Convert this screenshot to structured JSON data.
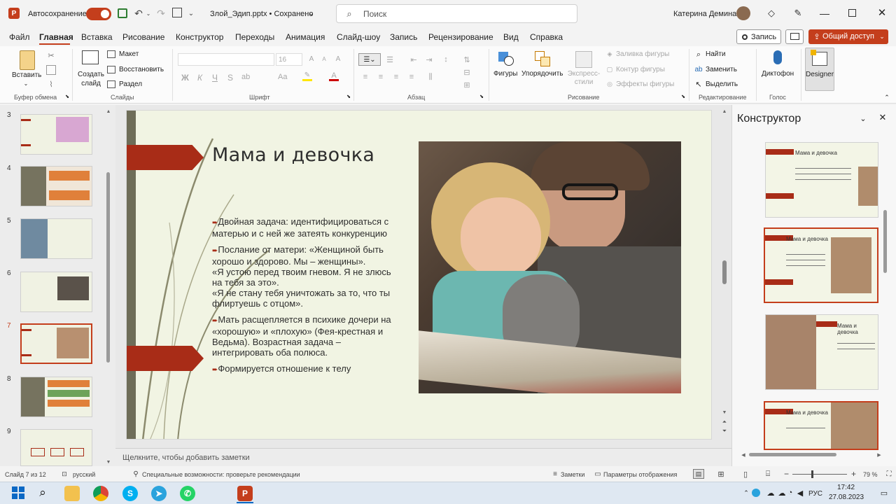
{
  "titlebar": {
    "autosave_label": "Автосохранение",
    "toggle_state": "Вкл",
    "file_title": "Злой_Эдип.pptx • Сохранено",
    "search_placeholder": "Поиск",
    "user_name": "Катерина Демина"
  },
  "menu": {
    "items": [
      "Файл",
      "Главная",
      "Вставка",
      "Рисование",
      "Конструктор",
      "Переходы",
      "Анимация",
      "Слайд-шоу",
      "Запись",
      "Рецензирование",
      "Вид",
      "Справка"
    ],
    "active": "Главная",
    "record_label": "Запись",
    "share_label": "Общий доступ"
  },
  "ribbon": {
    "clipboard": {
      "paste": "Вставить",
      "label": "Буфер обмена"
    },
    "slides": {
      "new_slide": "Создать слайд",
      "layout": "Макет",
      "reset": "Восстановить",
      "section": "Раздел",
      "label": "Слайды"
    },
    "font": {
      "font_size": "16",
      "bold": "Ж",
      "italic": "К",
      "underline": "Ч",
      "strike": "S",
      "spacing": "ab",
      "font_case": "Aa",
      "label": "Шрифт"
    },
    "paragraph": {
      "label": "Абзац"
    },
    "drawing": {
      "shapes": "Фигуры",
      "arrange": "Упорядочить",
      "quick_styles": "Экспресс-стили",
      "fill": "Заливка фигуры",
      "outline": "Контур фигуры",
      "effects": "Эффекты фигуры",
      "label": "Рисование"
    },
    "editing": {
      "find": "Найти",
      "replace": "Заменить",
      "select": "Выделить",
      "label": "Редактирование"
    },
    "voice": {
      "dictate": "Диктофон",
      "label": "Голос"
    },
    "designer": {
      "label": "Designer"
    }
  },
  "thumbnails": {
    "numbers": [
      "3",
      "4",
      "5",
      "6",
      "7",
      "8",
      "9"
    ],
    "active": "7"
  },
  "slide": {
    "title": "Мама и девочка",
    "bullets": [
      "Двойная задача: идентифицироваться с матерью и с ней же затеять конкуренцию",
      "Послание от матери: «Женщиной быть хорошо и здорово. Мы – женщины».\n«Я устою перед твоим гневом. Я не злюсь на тебя за это».\n«Я не стану тебя уничтожать за то, что ты флиртуешь  с отцом».",
      "Мать расщепляется в психике дочери на «хорошую» и «плохую» (Фея-крестная и Ведьма). Возрастная задача – интегрировать оба полюса.",
      "Формируется отношение к телу"
    ]
  },
  "notes_placeholder": "Щелкните, чтобы добавить заметки",
  "designer_pane": {
    "title": "Конструктор",
    "card_titles": [
      "Мама и девочка",
      "Мама и девочка",
      "Мама и девочка",
      "Мама и девочка"
    ]
  },
  "status": {
    "slide_count": "Слайд 7 из 12",
    "language": "русский",
    "accessibility": "Специальные возможности: проверьте рекомендации",
    "notes": "Заметки",
    "display": "Параметры отображения",
    "zoom": "79 %"
  },
  "taskbar": {
    "lang": "РУС",
    "time": "17:42",
    "date": "27.08.2023"
  },
  "colors": {
    "accent_red": "#c43e1c",
    "brand_dark_red": "#a82c17",
    "slide_bg": "#f3f5e6"
  }
}
